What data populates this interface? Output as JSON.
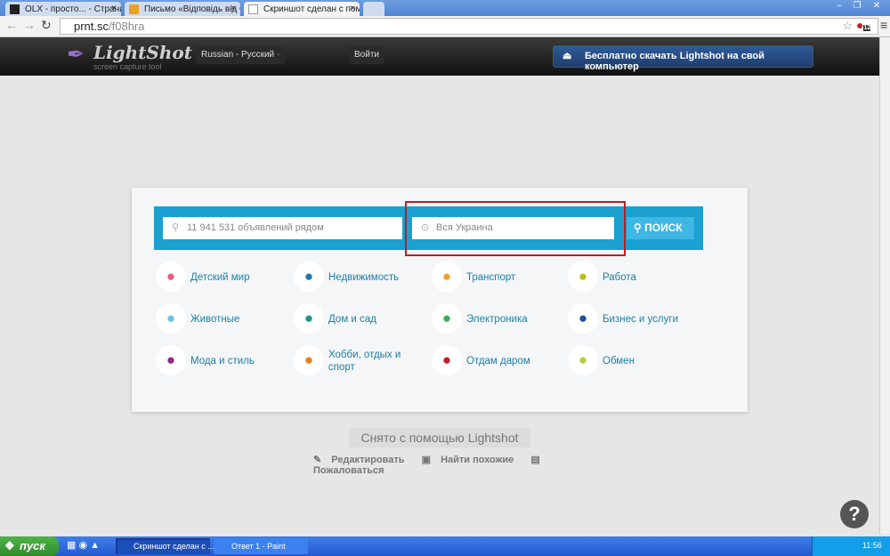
{
  "browser": {
    "tabs": [
      {
        "title": "OLX - просто... - Страница"
      },
      {
        "title": "Письмо «Відповідь від OLX»"
      },
      {
        "title": "Скриншот сделан с помощ"
      }
    ],
    "url_host": "prnt.sc",
    "url_path": "/f08hra",
    "ext_badge": "12"
  },
  "header": {
    "logo": "LightShot",
    "logo_sub": "screen capture tool",
    "language": "Russian - Русский",
    "login": "Войти",
    "download": "Бесплатно скачать Lightshot на свой компьютер"
  },
  "olx": {
    "search_placeholder": "11 941 531 объявлений рядом",
    "location_placeholder": "Вся Украина",
    "search_button": "ПОИСК",
    "categories": [
      {
        "label": "Детский мир",
        "icon": "baby-icon",
        "color": "#e0607e"
      },
      {
        "label": "Недвижимость",
        "icon": "house-icon",
        "color": "#1e73b8"
      },
      {
        "label": "Транспорт",
        "icon": "car-icon",
        "color": "#f0a030"
      },
      {
        "label": "Работа",
        "icon": "briefcase-icon",
        "color": "#b8c020"
      },
      {
        "label": "Животные",
        "icon": "paw-icon",
        "color": "#6cc0e8"
      },
      {
        "label": "Дом и сад",
        "icon": "sofa-icon",
        "color": "#1a9a8a"
      },
      {
        "label": "Электроника",
        "icon": "phone-icon",
        "color": "#3cb050"
      },
      {
        "label": "Бизнес и услуги",
        "icon": "wrench-icon",
        "color": "#2050a0"
      },
      {
        "label": "Мода и стиль",
        "icon": "coat-icon",
        "color": "#8a2a80"
      },
      {
        "label": "Хобби, отдых и спорт",
        "icon": "bicycle-icon",
        "color": "#e08020"
      },
      {
        "label": "Отдам даром",
        "icon": "tag-icon",
        "color": "#c02030"
      },
      {
        "label": "Обмен",
        "icon": "handshake-icon",
        "color": "#b0d040"
      }
    ]
  },
  "footer": {
    "caption": "Снято с помощью Lightshot",
    "edit": "Редактировать",
    "similar": "Найти похожие",
    "report": "Пожаловаться",
    "help": "?"
  },
  "taskbar": {
    "start": "пуск",
    "items": [
      "Скриншот сделан с ...",
      "Ответ 1 - Paint"
    ],
    "clock": "11:56"
  }
}
